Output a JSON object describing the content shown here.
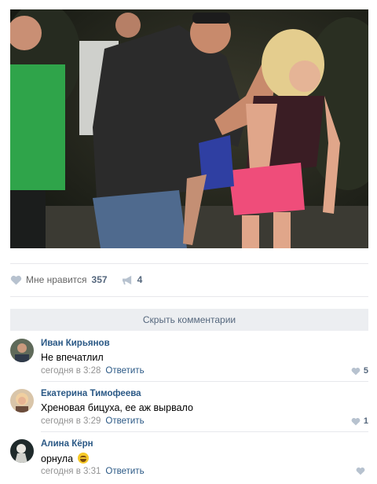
{
  "post": {
    "likes_label": "Мне нравится",
    "likes_count": "357",
    "shares_count": "4"
  },
  "comments_toggle": "Скрыть комментарии",
  "comments": [
    {
      "author": "Иван Кирьянов",
      "text": "Не впечатлил",
      "time": "сегодня в 3:28",
      "reply": "Ответить",
      "likes": "5"
    },
    {
      "author": "Екатерина Тимофеева",
      "text": "Хреновая бицуха, ее аж вырвало",
      "time": "сегодня в 3:29",
      "reply": "Ответить",
      "likes": "1"
    },
    {
      "author": "Алина Кёрн",
      "text": "орнула",
      "time": "сегодня в 3:31",
      "reply": "Ответить",
      "likes": ""
    }
  ],
  "icons": {
    "like": "heart-icon",
    "share": "megaphone-icon",
    "emoji": "laughing-tears-emoji"
  },
  "colors": {
    "link": "#2a5885",
    "muted": "#939393",
    "count": "#55677d",
    "heart": "#b7c2cf",
    "toggle_bg": "#eceef1"
  }
}
